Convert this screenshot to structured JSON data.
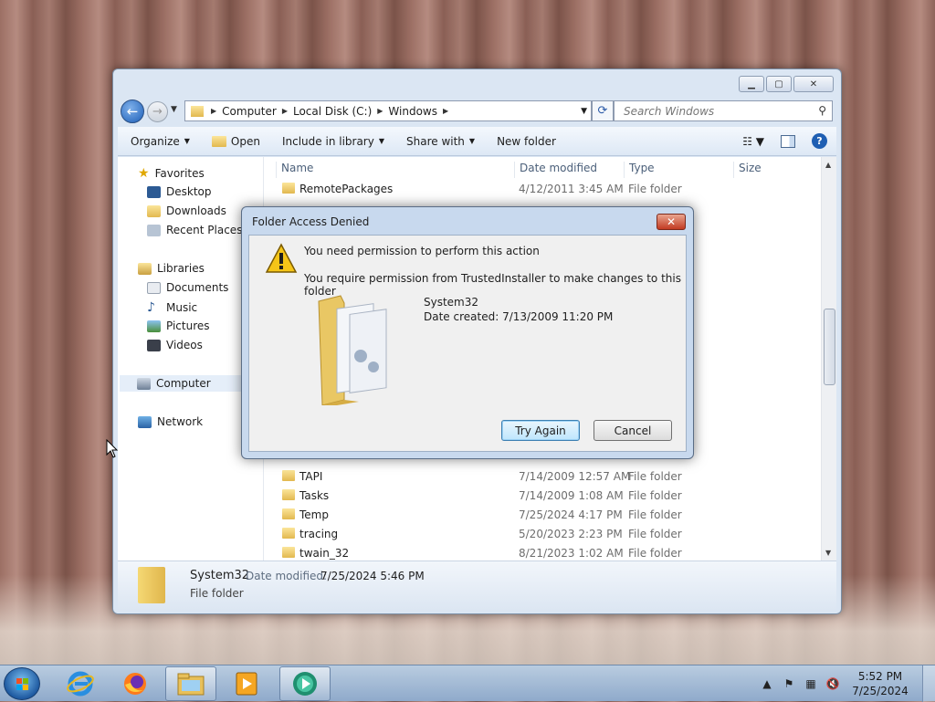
{
  "explorer": {
    "breadcrumb": [
      "Computer",
      "Local Disk (C:)",
      "Windows"
    ],
    "search_placeholder": "Search Windows",
    "toolbar": {
      "organize": "Organize",
      "open": "Open",
      "include_in_library": "Include in library",
      "share_with": "Share with",
      "new_folder": "New folder"
    },
    "nav": {
      "favorites": "Favorites",
      "desktop": "Desktop",
      "downloads": "Downloads",
      "recent_places": "Recent Places",
      "libraries": "Libraries",
      "documents": "Documents",
      "music": "Music",
      "pictures": "Pictures",
      "videos": "Videos",
      "computer": "Computer",
      "network": "Network"
    },
    "columns": {
      "name": "Name",
      "date_modified": "Date modified",
      "type": "Type",
      "size": "Size"
    },
    "rows_top": [
      {
        "name": "RemotePackages",
        "date": "4/12/2011 3:45 AM",
        "type": "File folder"
      }
    ],
    "rows_bottom": [
      {
        "name": "TAPI",
        "date": "7/14/2009 12:57 AM",
        "type": "File folder"
      },
      {
        "name": "Tasks",
        "date": "7/14/2009 1:08 AM",
        "type": "File folder"
      },
      {
        "name": "Temp",
        "date": "7/25/2024 4:17 PM",
        "type": "File folder"
      },
      {
        "name": "tracing",
        "date": "5/20/2023 2:23 PM",
        "type": "File folder"
      },
      {
        "name": "twain_32",
        "date": "8/21/2023 1:02 AM",
        "type": "File folder"
      }
    ],
    "details": {
      "name": "System32",
      "modified_label": "Date modified:",
      "modified_value": "7/25/2024 5:46 PM",
      "type": "File folder"
    }
  },
  "dialog": {
    "title": "Folder Access Denied",
    "message1": "You need permission to perform this action",
    "message2": "You require permission from TrustedInstaller to make changes to this folder",
    "folder_name": "System32",
    "date_created": "Date created: 7/13/2009 11:20 PM",
    "try_again": "Try Again",
    "cancel": "Cancel"
  },
  "taskbar": {
    "time": "5:52 PM",
    "date": "7/25/2024"
  },
  "icons": {
    "warning": "warning-triangle-icon",
    "folder": "folder-icon"
  },
  "colors": {
    "accent": "#1f5fb3",
    "dialog_frame": "#c8d9ee",
    "close_red": "#c23a22"
  }
}
